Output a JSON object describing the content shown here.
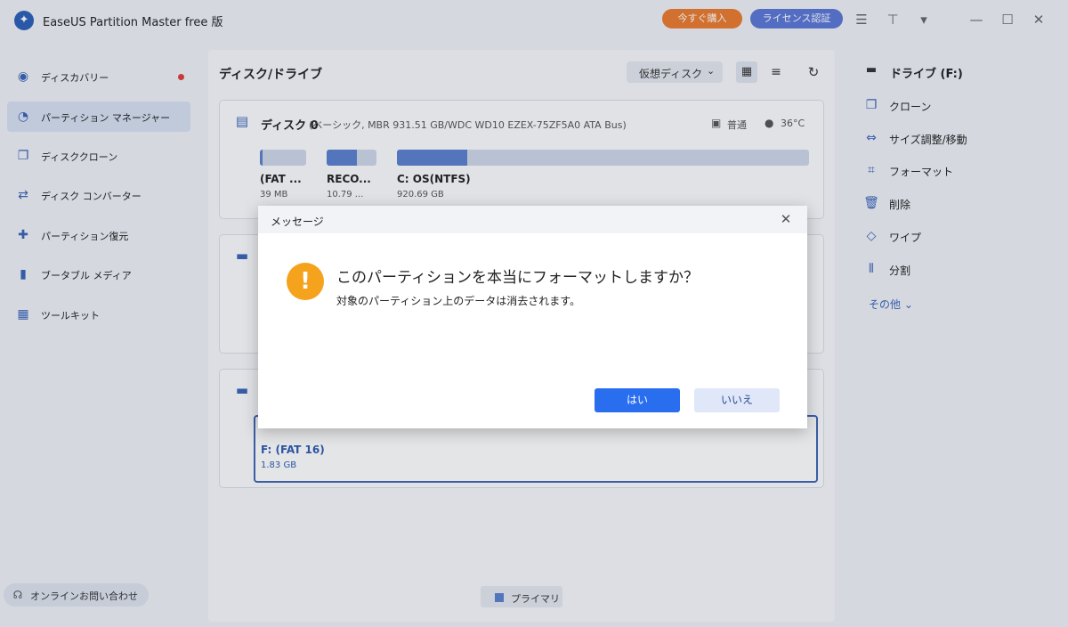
{
  "app": {
    "title": "EaseUS Partition Master free 版",
    "buy_label": "今すぐ購入",
    "license_label": "ライセンス認証",
    "colors": {
      "buy": "#ea7a2e",
      "license": "#5b77d6",
      "accent": "#2a6ef0",
      "warning": "#f5a21c"
    }
  },
  "sidebar": {
    "items": [
      {
        "label": "ディスカバリー",
        "icon": "compass-icon",
        "notification": true
      },
      {
        "label": "パーティション マネージャー",
        "icon": "pie-icon",
        "active": true
      },
      {
        "label": "ディスククローン",
        "icon": "copy-icon"
      },
      {
        "label": "ディスク コンバーター",
        "icon": "convert-icon"
      },
      {
        "label": "パーティション復元",
        "icon": "recover-icon"
      },
      {
        "label": "ブータブル メディア",
        "icon": "usb-icon"
      },
      {
        "label": "ツールキット",
        "icon": "toolkit-icon"
      }
    ],
    "support_label": "オンラインお問い合わせ"
  },
  "main": {
    "title": "ディスク/ドライブ",
    "virtual_disk_label": "仮想ディスク",
    "disk0": {
      "name": "ディスク 0",
      "description": "(ベーシック, MBR 931.51 GB/WDC WD10 EZEX-75ZF5A0     ATA Bus)",
      "status": "普通",
      "temperature": "36°C",
      "partitions": [
        {
          "name": "(FAT ...",
          "size": "39 MB",
          "used_fraction": 0.05
        },
        {
          "name": "RECO...",
          "size": "10.79 ...",
          "used_fraction": 0.6
        },
        {
          "name": "C: OS(NTFS)",
          "size": "920.69 GB",
          "used_fraction": 0.17
        }
      ]
    },
    "selected_partition": {
      "name": "F: (FAT 16)",
      "size": "1.83 GB"
    },
    "legend_label": "プライマリ"
  },
  "right_panel": {
    "drive_label": "ドライブ (F:)",
    "actions": [
      {
        "label": "クローン",
        "icon": "clone-icon"
      },
      {
        "label": "サイズ調整/移動",
        "icon": "resize-icon"
      },
      {
        "label": "フォーマット",
        "icon": "format-icon"
      },
      {
        "label": "削除",
        "icon": "trash-icon"
      },
      {
        "label": "ワイプ",
        "icon": "eraser-icon"
      },
      {
        "label": "分割",
        "icon": "split-icon"
      }
    ],
    "more_label": "その他"
  },
  "dialog": {
    "title": "メッセージ",
    "question": "このパーティションを本当にフォーマットしますか？",
    "detail": "対象のパーティション上のデータは消去されます。",
    "yes_label": "はい",
    "no_label": "いいえ"
  }
}
